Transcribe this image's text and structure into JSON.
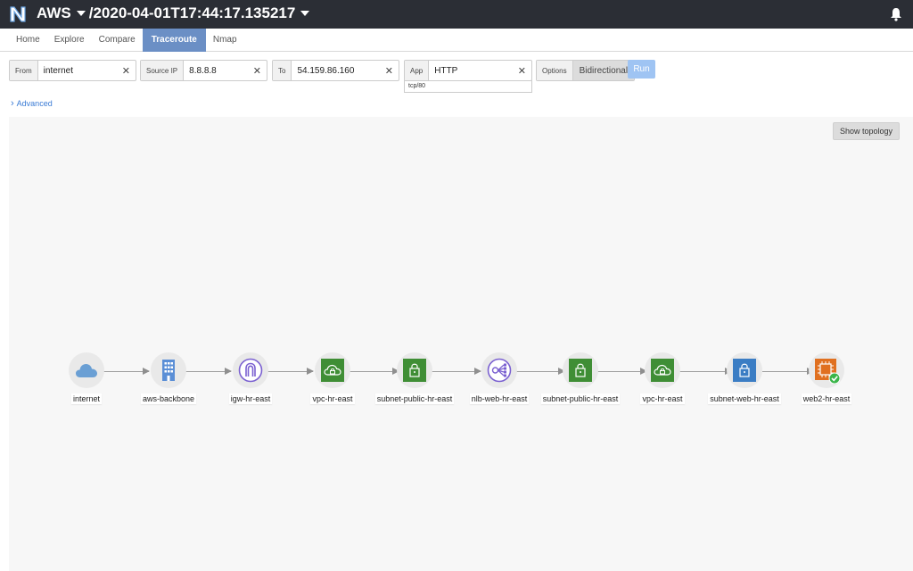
{
  "header": {
    "logo_letter": "N",
    "network": "AWS",
    "snapshot": "/2020-04-01T17:44:17.135217"
  },
  "tabs": [
    {
      "label": "Home",
      "active": false
    },
    {
      "label": "Explore",
      "active": false
    },
    {
      "label": "Compare",
      "active": false
    },
    {
      "label": "Traceroute",
      "active": true
    },
    {
      "label": "Nmap",
      "active": false
    }
  ],
  "query": {
    "from_label": "From",
    "from_value": "internet",
    "source_ip_label": "Source IP",
    "source_ip_value": "8.8.8.8",
    "to_label": "To",
    "to_value": "54.159.86.160",
    "app_label": "App",
    "app_value": "HTTP",
    "app_sub": "tcp/80",
    "options_label": "Options",
    "options_value": "Bidirectional",
    "run_label": "Run",
    "clear_glyph": "✕",
    "advanced_label": "Advanced"
  },
  "canvas": {
    "show_topology_label": "Show topology"
  },
  "path": {
    "nodes": [
      {
        "label": "internet",
        "icon": "cloud-icon"
      },
      {
        "label": "aws-backbone",
        "icon": "building-icon"
      },
      {
        "label": "igw-hr-east",
        "icon": "internet-gateway-icon"
      },
      {
        "label": "vpc-hr-east",
        "icon": "vpc-icon"
      },
      {
        "label": "subnet-public-hr-east",
        "icon": "subnet-lock-icon"
      },
      {
        "label": "nlb-web-hr-east",
        "icon": "load-balancer-icon"
      },
      {
        "label": "subnet-public-hr-east",
        "icon": "subnet-lock-icon"
      },
      {
        "label": "vpc-hr-east",
        "icon": "vpc-icon"
      },
      {
        "label": "subnet-web-hr-east",
        "icon": "subnet-lock-icon"
      },
      {
        "label": "web2-hr-east",
        "icon": "ec2-instance-icon"
      }
    ],
    "colors": {
      "cloud": "#6a9fd4",
      "building": "#5b8fd6",
      "gateway": "#7b61d1",
      "vpc": "#3f8e35",
      "subnet_public": "#3f8e35",
      "subnet_web": "#3b7dc4",
      "ec2": "#e07020",
      "success": "#3bb54a"
    }
  }
}
